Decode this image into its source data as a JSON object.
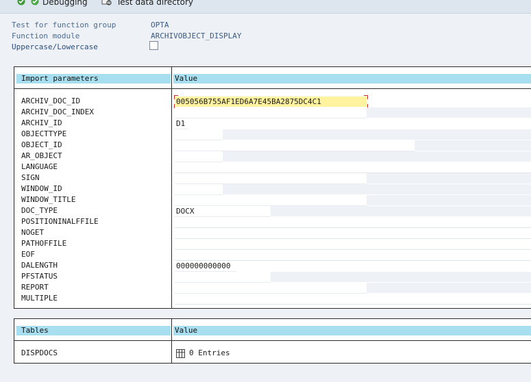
{
  "toolbar": {
    "debugging_label": "Debugging",
    "test_data_label": "Test data directory"
  },
  "header": {
    "group_label": "Test for function group",
    "group_value": "OPTA",
    "module_label": "Function module",
    "module_value": "ARCHIVOBJECT_DISPLAY",
    "case_label": "Uppercase/Lowercase",
    "case_checked": false
  },
  "import": {
    "col_param": "Import parameters",
    "col_value": "Value",
    "rows": [
      {
        "name": "ARCHIV_DOC_ID",
        "value": "005056B755AF1ED6A7E45BA2875DC4C1"
      },
      {
        "name": "ARCHIV_DOC_INDEX",
        "value": ""
      },
      {
        "name": "ARCHIV_ID",
        "value": "D1"
      },
      {
        "name": "OBJECTTYPE",
        "value": ""
      },
      {
        "name": "OBJECT_ID",
        "value": ""
      },
      {
        "name": "AR_OBJECT",
        "value": ""
      },
      {
        "name": "LANGUAGE",
        "value": ""
      },
      {
        "name": "SIGN",
        "value": ""
      },
      {
        "name": "WINDOW_ID",
        "value": ""
      },
      {
        "name": "WINDOW_TITLE",
        "value": ""
      },
      {
        "name": "DOC_TYPE",
        "value": "DOCX"
      },
      {
        "name": "POSITIONINALFFILE",
        "value": ""
      },
      {
        "name": "NOGET",
        "value": ""
      },
      {
        "name": "PATHOFFILE",
        "value": ""
      },
      {
        "name": "EOF",
        "value": ""
      },
      {
        "name": "DALENGTH",
        "value": "000000000000"
      },
      {
        "name": "PFSTATUS",
        "value": ""
      },
      {
        "name": "REPORT",
        "value": ""
      },
      {
        "name": "MULTIPLE",
        "value": ""
      }
    ]
  },
  "tables": {
    "col_name": "Tables",
    "col_value": "Value",
    "rows": [
      {
        "name": "DISPDOCS",
        "entries": "0 Entries"
      }
    ]
  }
}
